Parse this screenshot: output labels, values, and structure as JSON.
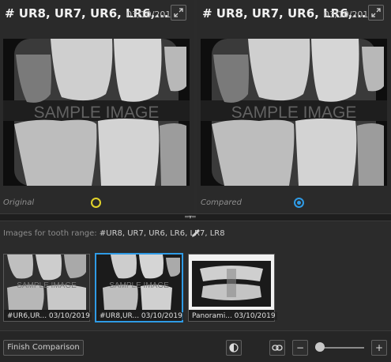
{
  "left_pane": {
    "title": "# UR8, UR7, UR6, LR6,...",
    "date": "03/10/2019",
    "watermark": "SAMPLE IMAGE",
    "caption": "Original",
    "marker_color": "#e2d32a"
  },
  "right_pane": {
    "title": "# UR8, UR7, UR6, LR6,...",
    "date": "03/10/2019",
    "watermark": "SAMPLE IMAGE",
    "caption": "Compared",
    "marker_color": "#2f9be6"
  },
  "tooth_range": {
    "label": "Images for tooth range:",
    "value": "#UR8, UR7, UR6, LR6, LR7, LR8"
  },
  "thumbnails": [
    {
      "label": "#UR6,UR... 03/10/2019",
      "watermark": "SAMPLE IMAGE",
      "selected": false
    },
    {
      "label": "#UR8,UR... 03/10/2019",
      "watermark": "SAMPLE IMAGE",
      "selected": true
    },
    {
      "label": "Panorami... 03/10/2019",
      "watermark": "",
      "selected": false
    }
  ],
  "bottom_bar": {
    "finish_label": "Finish Comparison",
    "contrast_icon": "contrast-icon",
    "link_icon": "link-icon",
    "zoom_out_label": "−",
    "zoom_in_label": "+",
    "zoom_level": 0.1
  },
  "colors": {
    "accent": "#2f9be6",
    "background": "#2b2b2b"
  }
}
